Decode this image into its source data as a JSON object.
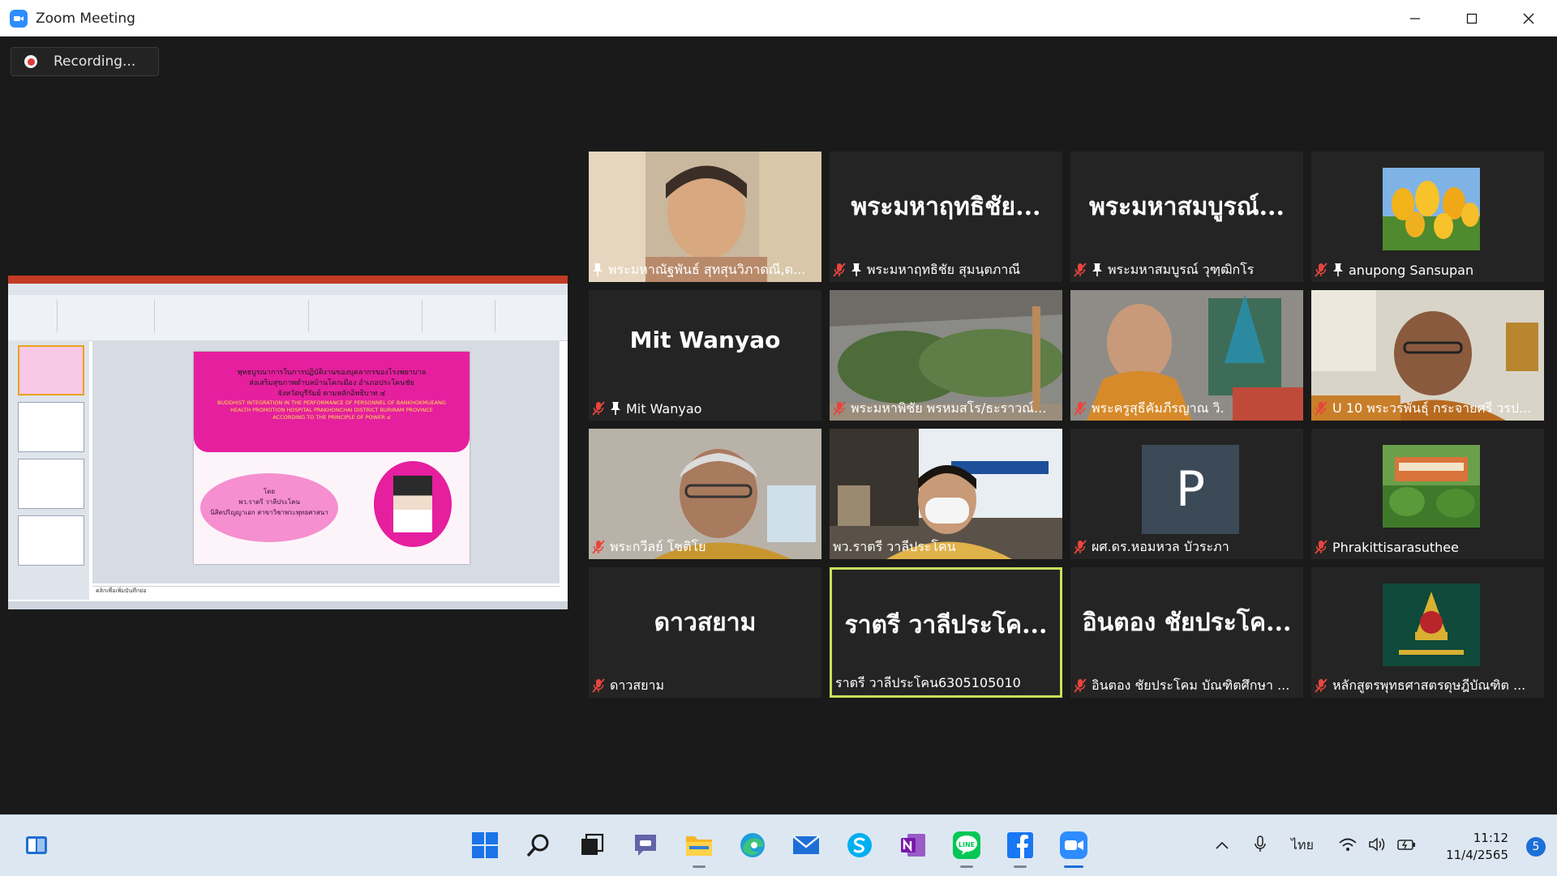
{
  "window": {
    "title": "Zoom Meeting"
  },
  "recording": {
    "label": "Recording..."
  },
  "share": {
    "slide_title_th": [
      "พุทธบูรณาการในการปฏิบัติงานของบุคลากรของโรงพยาบาล",
      "ส่งเสริมสุขภาพตำบลบ้านโคกเมือง อำเภอประโคนชัย",
      "จังหวัดบุรีรัมย์ ตามหลักอิทธิบาท ๔"
    ],
    "slide_title_en": [
      "BUDDHIST INTEGRATION IN THE PERFORMANCE OF PERSONNEL OF BANKHOKMUEANG",
      "HEALTH PROMOTION HOSPITAL PRAKHONCHAI DISTRICT BURIRAM PROVINCE",
      "ACCORDING TO THE PRINCIPLE OF POWER ๔"
    ],
    "slide_by": [
      "โดย",
      "พว.ราตรี วาลีประโคน",
      "นิสิตปริญญาเอก สาขาวิชาพระพุทธศาสนา"
    ],
    "notes_placeholder": "คลิกเพื่อเพิ่มบันทึกย่อ"
  },
  "participants": [
    {
      "name": "พระมหาณัฐพันธ์ สุทสุนวิภาดณี,ด...",
      "type": "video",
      "muted": false,
      "pinned": true,
      "big": ""
    },
    {
      "name": "พระมหาฤทธิชัย สุมนฺตภาณี",
      "type": "name",
      "muted": true,
      "pinned": true,
      "big": "พระมหาฤทธิชัย..."
    },
    {
      "name": "พระมหาสมบูรณ์ วุฑฺฒิกโร",
      "type": "name",
      "muted": true,
      "pinned": true,
      "big": "พระมหาสมบูรณ์..."
    },
    {
      "name": "anupong Sansupan",
      "type": "photo-tulips",
      "muted": true,
      "pinned": true,
      "big": ""
    },
    {
      "name": "Mit Wanyao",
      "type": "name",
      "muted": true,
      "pinned": true,
      "big": "Mit Wanyao"
    },
    {
      "name": "พระมหาพิชัย พรหมสโร/ธะราวณ์...",
      "type": "video-trees",
      "muted": true,
      "pinned": false,
      "big": ""
    },
    {
      "name": "พระครูสุธีคัมภีรญาณ วิ.",
      "type": "video-monk",
      "muted": true,
      "pinned": false,
      "big": ""
    },
    {
      "name": "U 10 พระวรพันธุ์ กระจายศรี วรป...",
      "type": "video-monk2",
      "muted": true,
      "pinned": false,
      "big": ""
    },
    {
      "name": "พระกวีลย์ โชติโย",
      "type": "video-elder",
      "muted": true,
      "pinned": false,
      "big": ""
    },
    {
      "name": "พว.ราตรี วาลีประโคน",
      "type": "video-mask",
      "muted": false,
      "pinned": false,
      "big": ""
    },
    {
      "name": "ผศ.ดร.หอมหวล บัวระภา",
      "type": "avatar-letter",
      "muted": true,
      "pinned": false,
      "big": "P"
    },
    {
      "name": "Phrakittisarasuthee",
      "type": "photo-building",
      "muted": true,
      "pinned": false,
      "big": ""
    },
    {
      "name": "ดาวสยาม",
      "type": "name",
      "muted": true,
      "pinned": false,
      "big": "ดาวสยาม"
    },
    {
      "name": "ราตรี วาลีประโคน6305105010",
      "type": "name",
      "muted": false,
      "pinned": false,
      "big": "ราตรี วาลีประโค...",
      "active": true
    },
    {
      "name": "อินตอง ชัยประโคม บัณฑิตศึกษา ...",
      "type": "name",
      "muted": true,
      "pinned": false,
      "big": "อินตอง ชัยประโค..."
    },
    {
      "name": "หลักสูตรพุทธศาสตรดุษฎีบัณฑิต ...",
      "type": "photo-logo",
      "muted": true,
      "pinned": false,
      "big": ""
    }
  ],
  "taskbar": {
    "icons": [
      "start-icon",
      "search-icon",
      "task-view-icon",
      "teams-chat-icon",
      "file-explorer-icon",
      "edge-icon",
      "mail-icon",
      "skype-icon",
      "onenote-icon",
      "line-icon",
      "facebook-icon",
      "zoom-icon"
    ],
    "language": "ไทย",
    "time": "11:12",
    "date": "11/4/2565",
    "notifications": "5"
  },
  "colors": {
    "zoom_blue": "#2D8CFF",
    "active_speaker": "#c9e05a",
    "mute_red": "#e8453c",
    "slide_pink": "#e51f9e"
  }
}
